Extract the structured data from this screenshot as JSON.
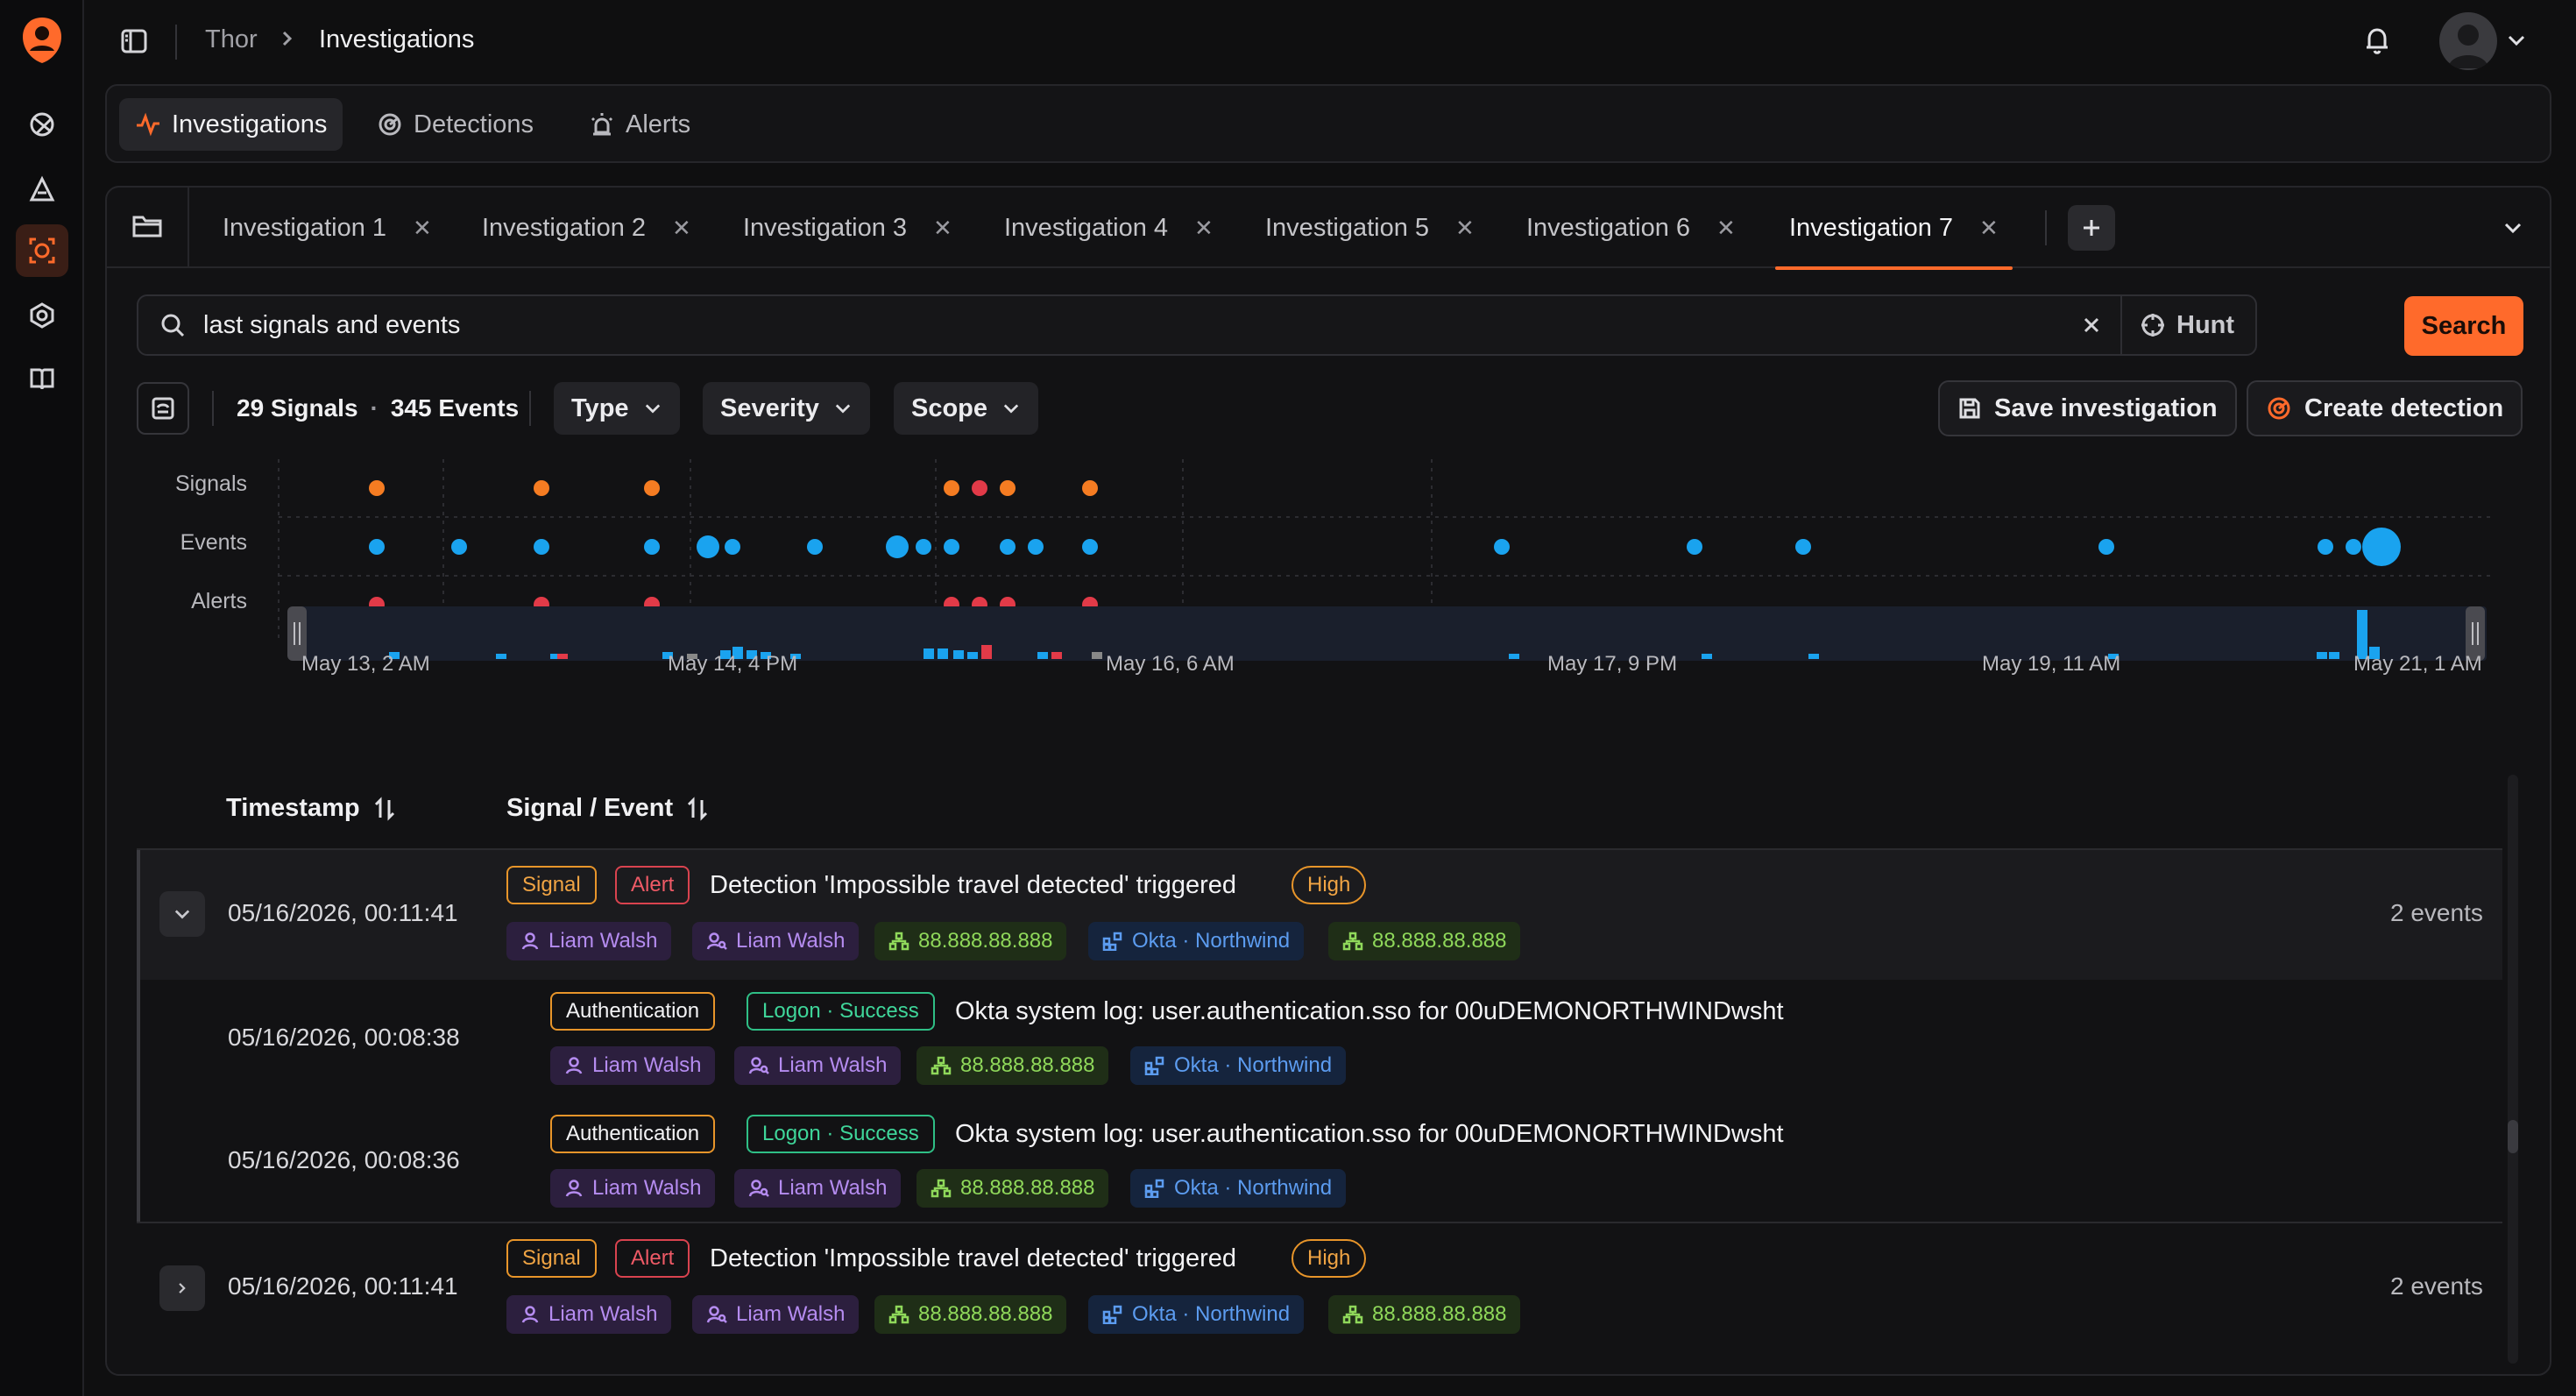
{
  "breadcrumb": {
    "root": "Thor",
    "current": "Investigations"
  },
  "nav": {
    "tabs": [
      {
        "label": "Investigations",
        "icon": "activity-icon"
      },
      {
        "label": "Detections",
        "icon": "radar-icon"
      },
      {
        "label": "Alerts",
        "icon": "siren-icon"
      }
    ]
  },
  "investigation_tabs": [
    "Investigation 1",
    "Investigation 2",
    "Investigation 3",
    "Investigation 4",
    "Investigation 5",
    "Investigation 6",
    "Investigation 7"
  ],
  "active_investigation": "Investigation 7",
  "search": {
    "query": "last signals and events",
    "hunt_label": "Hunt",
    "search_label": "Search"
  },
  "toolbar": {
    "signals_count": "29 Signals",
    "separator": "·",
    "events_count": "345 Events",
    "filters": [
      "Type",
      "Severity",
      "Scope"
    ],
    "save_label": "Save investigation",
    "create_label": "Create detection"
  },
  "timeline": {
    "lanes": [
      "Signals",
      "Events",
      "Alerts"
    ],
    "ticks": [
      "May 13, 2 AM",
      "May 14, 4 PM",
      "May 16, 6 AM",
      "May 17, 9 PM",
      "May 19, 11 AM",
      "May 21, 1 AM"
    ]
  },
  "table": {
    "headers": {
      "timestamp": "Timestamp",
      "signal_event": "Signal / Event"
    },
    "rows": [
      {
        "timestamp": "05/16/2026, 00:11:41",
        "type": "Signal",
        "category": "Alert",
        "message": "Detection 'Impossible travel detected' triggered",
        "severity": "High",
        "entities": [
          "Liam Walsh",
          "Liam Walsh",
          "88.888.88.888",
          "Okta · Northwind",
          "88.888.88.888"
        ],
        "count": "2 events",
        "expanded": true,
        "children": [
          {
            "timestamp": "05/16/2026, 00:08:38",
            "type": "Authentication",
            "category": "Logon · Success",
            "message": "Okta system log: user.authentication.sso for 00uDEMONORTHWINDwsht",
            "entities": [
              "Liam Walsh",
              "Liam Walsh",
              "88.888.88.888",
              "Okta · Northwind"
            ]
          },
          {
            "timestamp": "05/16/2026, 00:08:36",
            "type": "Authentication",
            "category": "Logon · Success",
            "message": "Okta system log: user.authentication.sso for 00uDEMONORTHWINDwsht",
            "entities": [
              "Liam Walsh",
              "Liam Walsh",
              "88.888.88.888",
              "Okta · Northwind"
            ]
          }
        ]
      },
      {
        "timestamp": "05/16/2026, 00:11:41",
        "type": "Signal",
        "category": "Alert",
        "message": "Detection 'Impossible travel detected' triggered",
        "severity": "High",
        "entities": [
          "Liam Walsh",
          "Liam Walsh",
          "88.888.88.888",
          "Okta · Northwind",
          "88.888.88.888"
        ],
        "count": "2 events",
        "expanded": false
      }
    ]
  },
  "colors": {
    "accent": "#ff6a2b",
    "signal": "#f57c22",
    "event": "#1aa3ef",
    "alert": "#e23a48"
  }
}
